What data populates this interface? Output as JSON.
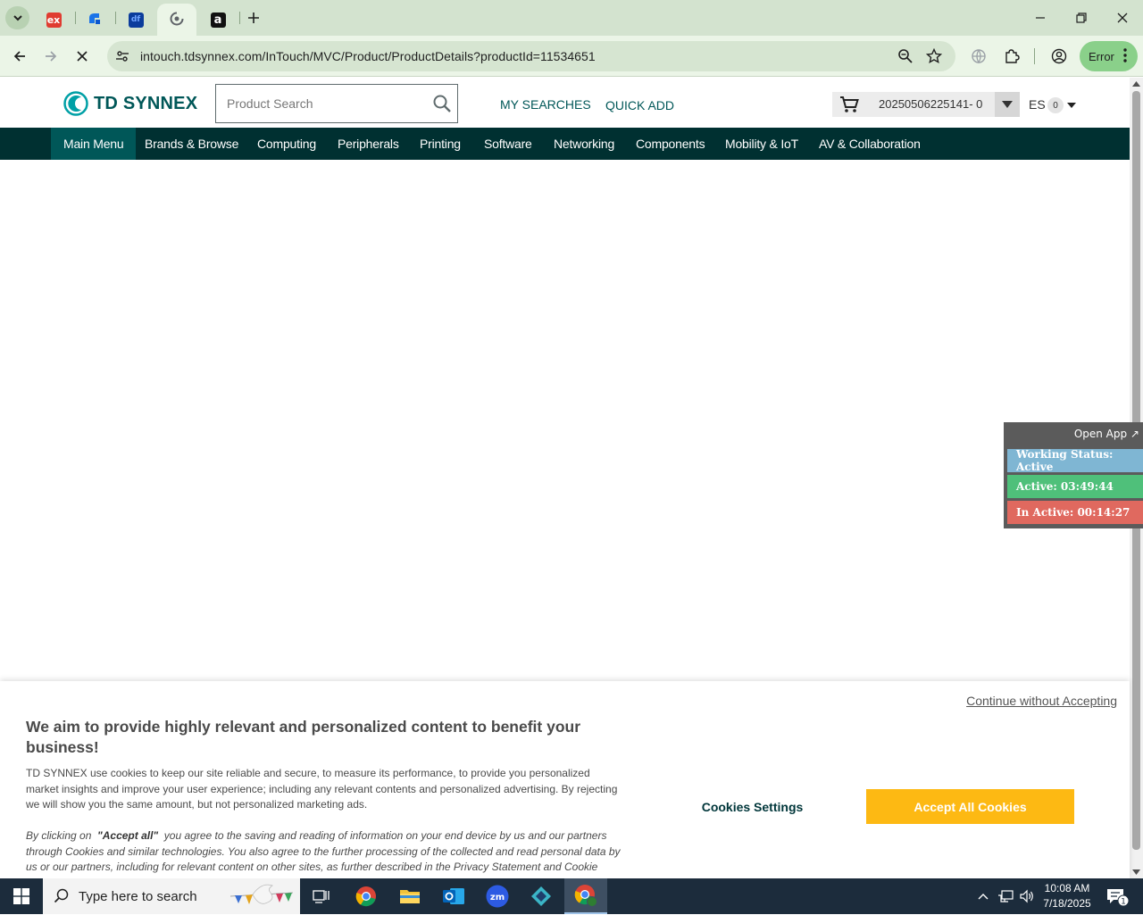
{
  "browser": {
    "tabs": [
      {
        "icon": "ex-favicon-icon",
        "glyph": "ex",
        "color": "#e03c31"
      },
      {
        "icon": "blue-app-favicon-icon",
        "glyph": "",
        "color": "#1a73e8"
      },
      {
        "icon": "df-favicon-icon",
        "glyph": "df",
        "color": "#0b3c9c"
      },
      {
        "icon": "loading-favicon-icon",
        "glyph": "",
        "color": "#5f6368"
      },
      {
        "icon": "amazon-favicon-icon",
        "glyph": "a",
        "color": "#111111"
      }
    ],
    "url_host": "intouch.tdsynnex.com",
    "url_path": "/InTouch/MVC/Product/ProductDetails?productId=11534651",
    "error_label": "Error"
  },
  "site": {
    "logo_text": "TD SYNNEX",
    "search_placeholder": "Product Search",
    "my_searches": "MY SEARCHES",
    "quick_add": "QUICK ADD",
    "cart_number": "20250506225141- 0",
    "lang": "ES",
    "lang_count": "0"
  },
  "nav": {
    "items": [
      "Main Menu",
      "Brands & Browse",
      "Computing",
      "Peripherals",
      "Printing",
      "Software",
      "Networking",
      "Components",
      "Mobility & IoT",
      "AV & Collaboration"
    ]
  },
  "tracker": {
    "open_app": "Open App ↗",
    "working_status": "Working Status: Active",
    "active": "Active: 03:49:44",
    "inactive": "In Active: 00:14:27",
    "colors": {
      "status": "#7fb6d3",
      "active": "#4fc07a",
      "inactive": "#e0695f"
    }
  },
  "cookie": {
    "continue": "Continue without Accepting",
    "heading": "We aim to provide highly relevant and personalized content to benefit your business!",
    "body": "TD SYNNEX use cookies to keep our site reliable and secure, to measure its performance, to provide you personalized market insights and improve your user experience; including any relevant contents and personalized advertising. By rejecting we will show you the same amount, but not personalized marketing ads.",
    "consent_prefix": "By clicking on",
    "consent_bold": "\"Accept all\"",
    "consent_rest": "you agree to the saving and reading of information on your end device by us and our partners through Cookies and similar technologies. You also agree to the further processing of the collected and read personal data by us or our partners, including for relevant content on other sites, as further described in the Privacy Statement and Cookie settings",
    "settings_button": "Cookies Settings",
    "accept_button": "Accept All Cookies",
    "accent_color": "#fdb913"
  },
  "taskbar": {
    "search_text": "Type here to search",
    "time": "10:08 AM",
    "date": "7/18/2025",
    "notification_count": "1"
  }
}
